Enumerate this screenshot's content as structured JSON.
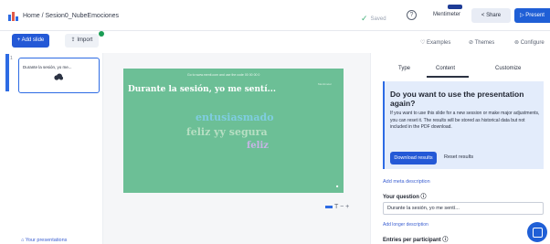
{
  "header": {
    "breadcrumb": "Home / Sesion0_NubeEmociones",
    "saved_label": "Saved",
    "help_label": "?",
    "brand": "Mentimeter",
    "share_label": "< Share",
    "present_label": "▷ Present"
  },
  "toolbar": {
    "add_slide": "+ Add slide",
    "import": "⇪ Import",
    "examples": "♡ Examples",
    "themes": "⊘ Themes",
    "configure": "⊚ Configure"
  },
  "slides": {
    "selected_number": "1",
    "thumb_text": "Durante la sesión, yo me...",
    "your_presentations": "⌂ Your presentations"
  },
  "slide": {
    "top_text": "Go to www.menti.com and use the code 00 00 00 0",
    "brand_mark": "Mentimeter",
    "question": "Durante la sesión, yo me sentí...",
    "words": [
      "entusiasmado",
      "feliz yy segura",
      "feliz"
    ],
    "corner_mark": "■",
    "zoom_controls": "T − +"
  },
  "panel": {
    "tabs": [
      "Type",
      "Content",
      "Customize"
    ],
    "active_tab": "Content",
    "info_title": "Do you want to use the presentation again?",
    "info_body": "If you want to use this slide for a new session or make major adjustments, you can reset it. The results will be stored as historical data but not included in the PDF download.",
    "download_results": "Download results",
    "reset_results": "Reset results",
    "add_meta": "Add meta description",
    "question_label": "Your question ⓘ",
    "question_value": "Durante la sesión, yo me sentí...",
    "add_longer": "Add longer description",
    "entries_label": "Entries per participant ⓘ"
  },
  "colors": {
    "accent": "#2459d6",
    "slide_bg": "#6cbf96",
    "info_bg": "#e3ecfb"
  }
}
